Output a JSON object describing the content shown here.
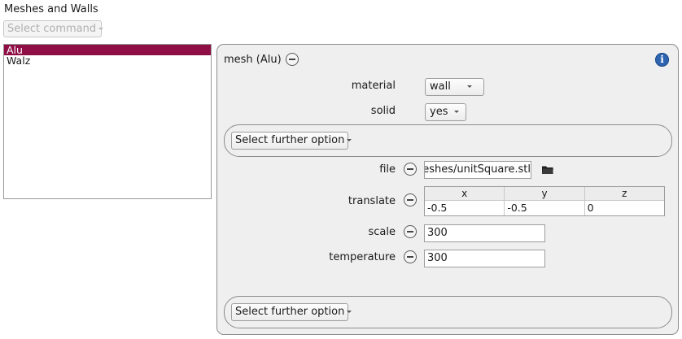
{
  "title": "Meshes and Walls",
  "command_select": {
    "placeholder": "Select command"
  },
  "items": [
    {
      "label": "Alu",
      "selected": true
    },
    {
      "label": "Walz",
      "selected": false
    }
  ],
  "panel": {
    "title": "mesh (Alu)",
    "fields": {
      "material": {
        "label": "material",
        "value": "wall"
      },
      "solid": {
        "label": "solid",
        "value": "yes"
      },
      "file": {
        "label": "file",
        "value": "meshes/unitSquare.stl"
      },
      "translate": {
        "label": "translate",
        "columns": [
          "x",
          "y",
          "z"
        ],
        "values": [
          "-0.5",
          "-0.5",
          "0"
        ]
      },
      "scale": {
        "label": "scale",
        "value": "300"
      },
      "temperature": {
        "label": "temperature",
        "value": "300"
      }
    },
    "further_option_top": "Select further option",
    "further_option_bottom": "Select further option"
  },
  "colors": {
    "selection": "#8e0e45",
    "info": "#2e64b0"
  },
  "icons": [
    "remove-icon",
    "info-icon",
    "folder-icon",
    "chevron-down-icon"
  ]
}
